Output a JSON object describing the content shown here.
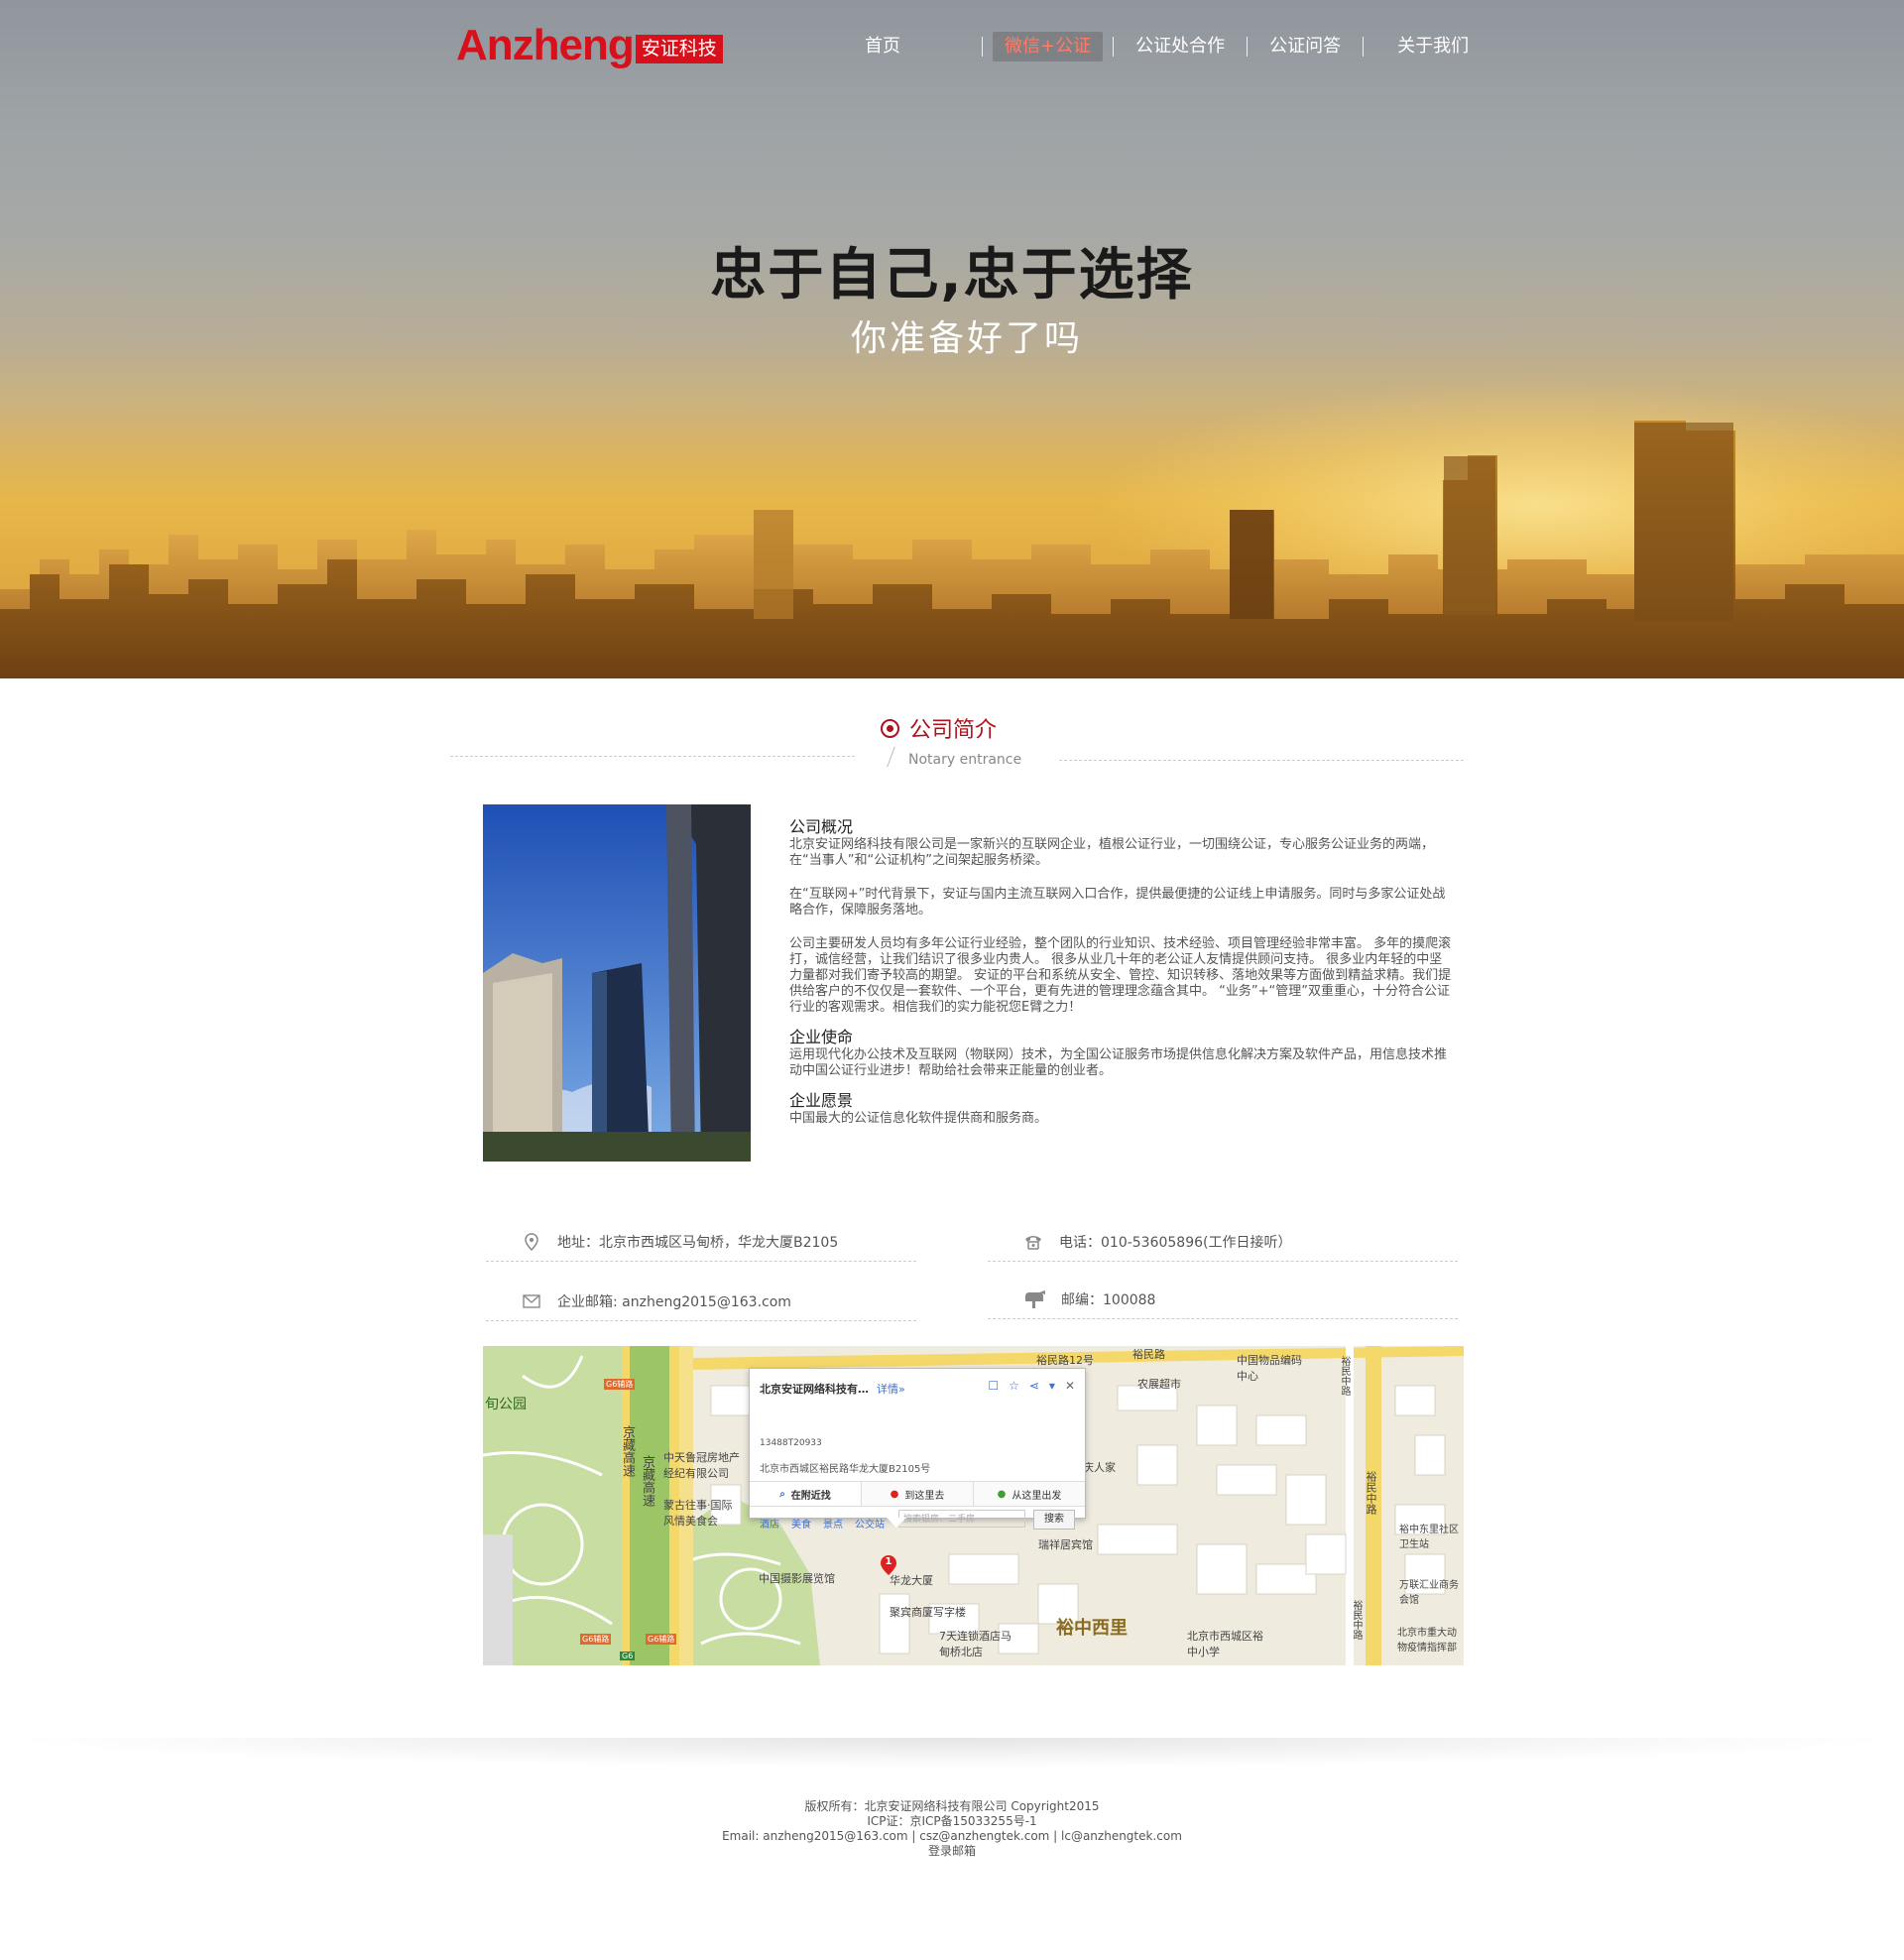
{
  "brand": {
    "name_en": "Anzheng",
    "name_cn": "安证科技"
  },
  "nav": {
    "items": [
      {
        "label": "首页",
        "active": false
      },
      {
        "label": "微信+公证",
        "active": true
      },
      {
        "label": "公证处合作",
        "active": false
      },
      {
        "label": "公证问答",
        "active": false
      },
      {
        "label": "关于我们",
        "active": false
      }
    ]
  },
  "hero": {
    "title": "忠于自己,忠于选择",
    "subtitle": "你准备好了吗"
  },
  "section": {
    "title": "公司简介",
    "subtitle": "Notary entrance"
  },
  "about": {
    "overview_title": "公司概况",
    "overview_p1": "北京安证网络科技有限公司是一家新兴的互联网企业，植根公证行业，一切围绕公证，专心服务公证业务的两端，在“当事人”和“公证机构”之间架起服务桥梁。",
    "overview_p2": "在“互联网+”时代背景下，安证与国内主流互联网入口合作，提供最便捷的公证线上申请服务。同时与多家公证处战略合作，保障服务落地。",
    "overview_p3": "公司主要研发人员均有多年公证行业经验，整个团队的行业知识、技术经验、项目管理经验非常丰富。 多年的摸爬滚打，诚信经营，让我们结识了很多业内贵人。 很多从业几十年的老公证人友情提供顾问支持。 很多业内年轻的中坚力量都对我们寄予较高的期望。 安证的平台和系统从安全、管控、知识转移、落地效果等方面做到精益求精。我们提供给客户的不仅仅是一套软件、一个平台，更有先进的管理理念蕴含其中。 “业务”+“管理”双重重心，十分符合公证行业的客观需求。相信我们的实力能祝您E臂之力！",
    "mission_title": "企业使命",
    "mission_text": " 运用现代化办公技术及互联网（物联网）技术，为全国公证服务市场提供信息化解决方案及软件产品，用信息技术推动中国公证行业进步！帮助给社会带来正能量的创业者。",
    "vision_title": "企业愿景",
    "vision_text": " 中国最大的公证信息化软件提供商和服务商。"
  },
  "contact": {
    "address": "地址：北京市西城区马甸桥，华龙大厦B2105",
    "phone": "电话：010-53605896(工作日接听）",
    "email": "企业邮箱:  anzheng2015@163.com",
    "postcode": "邮编：100088"
  },
  "map": {
    "popup_title": "北京安证网络科技有…",
    "popup_detail": "详情»",
    "popup_phone": "13488T20933",
    "popup_address": "北京市西城区裕民路华龙大厦B2105号",
    "tabs": [
      "在附近找",
      "到这里去",
      "从这里出发"
    ],
    "links": [
      "酒店",
      "美食",
      "景点",
      "公交站"
    ],
    "search_placeholder": "搜索银房、二手房",
    "search_button": "搜索",
    "labels": {
      "park": "旬公园",
      "road_top": "裕民路",
      "bus_stop": "裕民路12号",
      "museum": "中国物品编码中心",
      "market": "农展超市",
      "highway1": "京藏高速",
      "highway2": "京藏高速",
      "realty": "中天鲁冠房地产经纪有限公司",
      "restaurant": "蒙古往事·国际风情美食会",
      "people": "庆人家",
      "hotel": "瑞祥居宾馆",
      "hualong": "华龙大厦",
      "tower": "聚宾商厦写字楼",
      "photo": "中国摄影展览馆",
      "hotel7": "7天连锁酒店马甸桥北店",
      "area": "裕中西里",
      "school": "北京市西城区裕中小学",
      "community": "裕中东里社区卫生站",
      "mall": "万联汇业商务会馆",
      "office": "北京市重大动物疫情指挥部",
      "road_right": "裕民中路",
      "road_right2": "裕民中路",
      "road_right3": "裕民中路",
      "marker": "1",
      "g6a": "G6辅路",
      "g6b": "G6辅路",
      "g6c": "G6辅路",
      "g6": "G6"
    }
  },
  "footer": {
    "line1": "版权所有：北京安证网络科技有限公司 Copyright2015",
    "line2": "ICP证：京ICP备15033255号-1",
    "line3": "Email: anzheng2015@163.com | csz@anzhengtek.com | lc@anzhengtek.com",
    "line4": "登录邮箱"
  },
  "colors": {
    "brand_red": "#d8101c",
    "section_red": "#b1111b",
    "nav_active": "#ff7b6b",
    "link_blue": "#3a6fd6"
  }
}
